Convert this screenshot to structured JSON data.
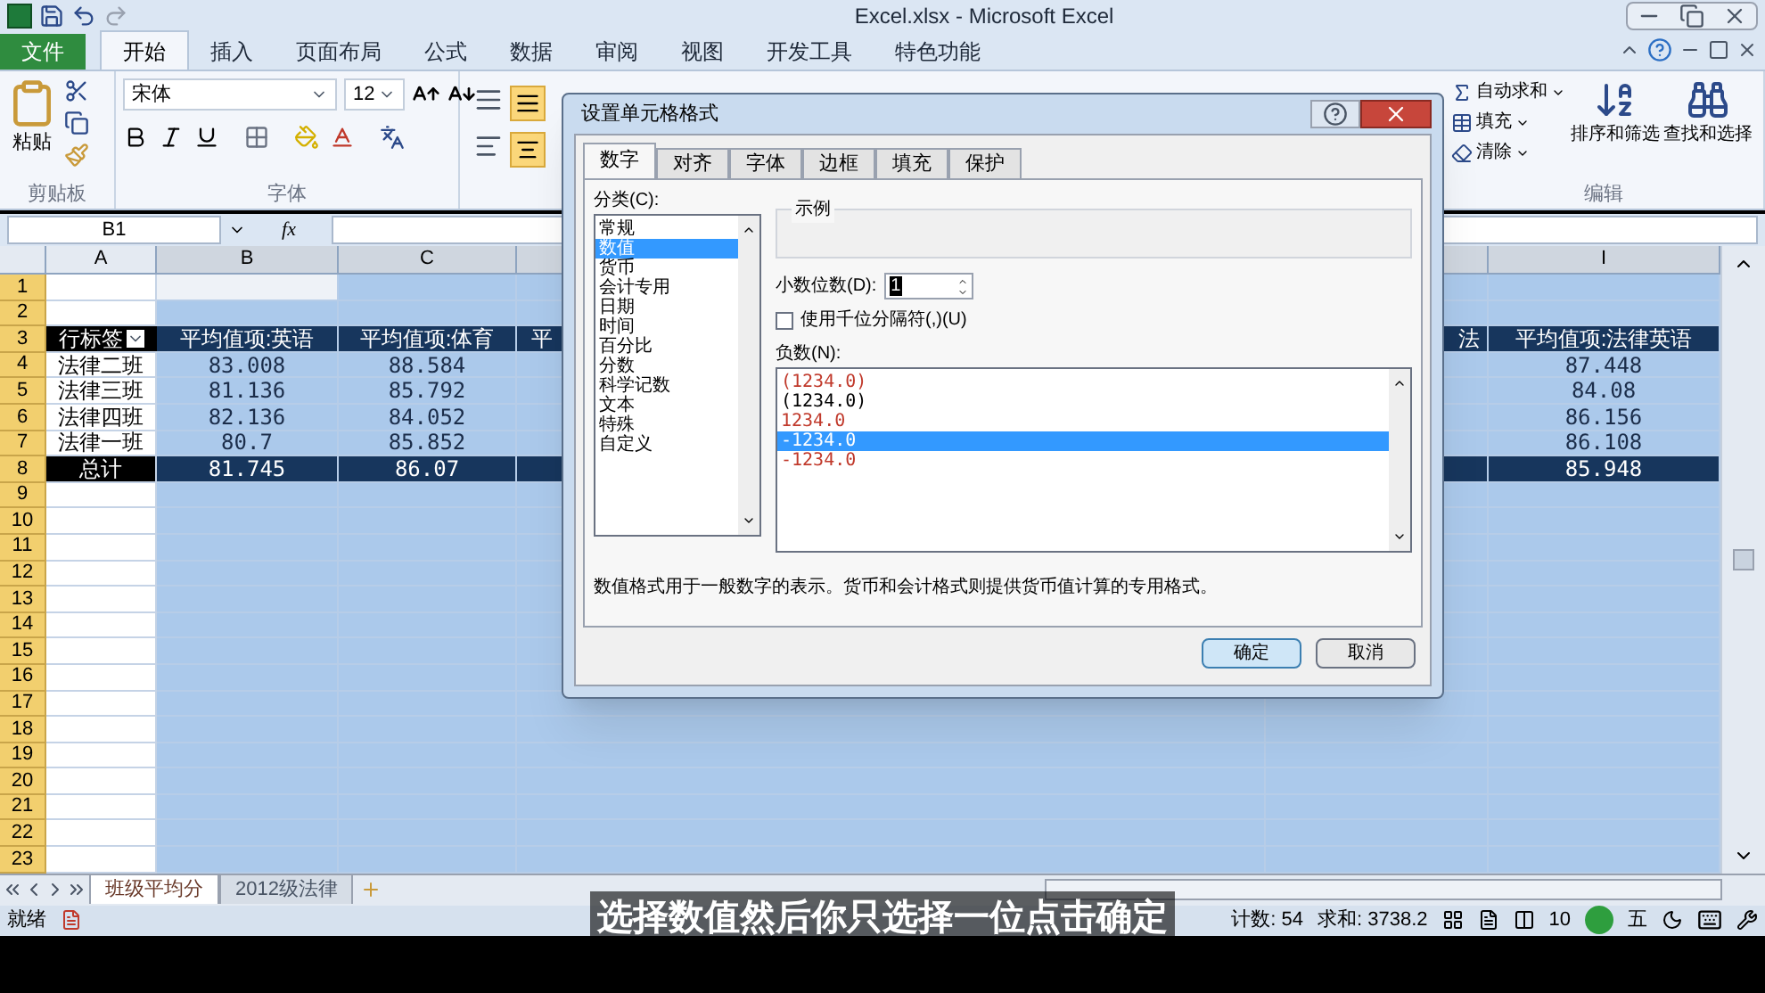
{
  "window": {
    "title": "Excel.xlsx - Microsoft Excel"
  },
  "ribbon_tabs": [
    {
      "label": "文件",
      "kind": "file",
      "selected": false
    },
    {
      "label": "开始",
      "kind": "tab",
      "selected": true
    },
    {
      "label": "插入",
      "kind": "tab",
      "selected": false
    },
    {
      "label": "页面布局",
      "kind": "tab",
      "selected": false
    },
    {
      "label": "公式",
      "kind": "tab",
      "selected": false
    },
    {
      "label": "数据",
      "kind": "tab",
      "selected": false
    },
    {
      "label": "审阅",
      "kind": "tab",
      "selected": false
    },
    {
      "label": "视图",
      "kind": "tab",
      "selected": false
    },
    {
      "label": "开发工具",
      "kind": "tab",
      "selected": false
    },
    {
      "label": "特色功能",
      "kind": "tab",
      "selected": false
    }
  ],
  "clipboard": {
    "paste": "粘贴",
    "group": "剪贴板"
  },
  "font": {
    "name": "宋体",
    "size": "12",
    "group": "字体"
  },
  "editing": {
    "items": [
      "自动求和",
      "填充",
      "清除"
    ],
    "sort": "排序和筛选",
    "find": "查找和选择",
    "group": "编辑"
  },
  "formula_bar": {
    "name_box": "B1",
    "fx": "fx"
  },
  "column_letters": [
    "A",
    "B",
    "C",
    "I"
  ],
  "row_numbers": [
    "1",
    "2",
    "3",
    "4",
    "5",
    "6",
    "7",
    "8",
    "9",
    "10",
    "11",
    "12",
    "13",
    "14",
    "15",
    "16",
    "17",
    "18",
    "19",
    "20",
    "21",
    "22",
    "23"
  ],
  "pivot": {
    "row_label": "行标签",
    "headers": [
      "平均值项:英语",
      "平均值项:体育",
      "平",
      "法",
      "平均值项:法律英语"
    ],
    "rows": [
      {
        "label": "法律二班",
        "values": [
          "83.008",
          "88.584",
          "87.448"
        ]
      },
      {
        "label": "法律三班",
        "values": [
          "81.136",
          "85.792",
          "84.08"
        ]
      },
      {
        "label": "法律四班",
        "values": [
          "82.136",
          "84.052",
          "86.156"
        ]
      },
      {
        "label": "法律一班",
        "values": [
          "80.7",
          "85.852",
          "86.108"
        ]
      }
    ],
    "total": {
      "label": "总计",
      "values": [
        "81.745",
        "86.07",
        "85.948"
      ]
    }
  },
  "sheet_tabs": [
    {
      "label": "班级平均分",
      "selected": true
    },
    {
      "label": "2012级法律",
      "selected": false
    }
  ],
  "status_bar": {
    "state": "就绪",
    "count": "计数: 54",
    "sum": "求和: 3738.2",
    "zoom": "10",
    "ime": "五"
  },
  "subtitle": "选择数值然后你只选择一位点击确定",
  "dialog": {
    "title": "设置单元格格式",
    "tabs": [
      {
        "label": "数字",
        "selected": true
      },
      {
        "label": "对齐",
        "selected": false
      },
      {
        "label": "字体",
        "selected": false
      },
      {
        "label": "边框",
        "selected": false
      },
      {
        "label": "填充",
        "selected": false
      },
      {
        "label": "保护",
        "selected": false
      }
    ],
    "category_label": "分类(C):",
    "categories": [
      {
        "label": "常规",
        "selected": false
      },
      {
        "label": "数值",
        "selected": true
      },
      {
        "label": "货币",
        "selected": false
      },
      {
        "label": "会计专用",
        "selected": false
      },
      {
        "label": "日期",
        "selected": false
      },
      {
        "label": "时间",
        "selected": false
      },
      {
        "label": "百分比",
        "selected": false
      },
      {
        "label": "分数",
        "selected": false
      },
      {
        "label": "科学记数",
        "selected": false
      },
      {
        "label": "文本",
        "selected": false
      },
      {
        "label": "特殊",
        "selected": false
      },
      {
        "label": "自定义",
        "selected": false
      }
    ],
    "sample_label": "示例",
    "decimal_label": "小数位数(D):",
    "decimal_value": "1",
    "thousands": {
      "label": "使用千位分隔符(,)(U)",
      "checked": false
    },
    "negative_label": "负数(N):",
    "negatives": [
      {
        "text": "(1234.0)",
        "color": "#c0392b",
        "selected": false
      },
      {
        "text": "(1234.0)",
        "color": "#000000",
        "selected": false
      },
      {
        "text": "1234.0",
        "color": "#c0392b",
        "selected": false
      },
      {
        "text": "-1234.0",
        "selected": true
      },
      {
        "text": "-1234.0",
        "color": "#c0392b",
        "selected": false
      }
    ],
    "description": "数值格式用于一般数字的表示。货币和会计格式则提供货币值计算的专用格式。",
    "buttons": [
      {
        "label": "确定",
        "selected": true
      },
      {
        "label": "取消",
        "selected": false
      }
    ]
  }
}
